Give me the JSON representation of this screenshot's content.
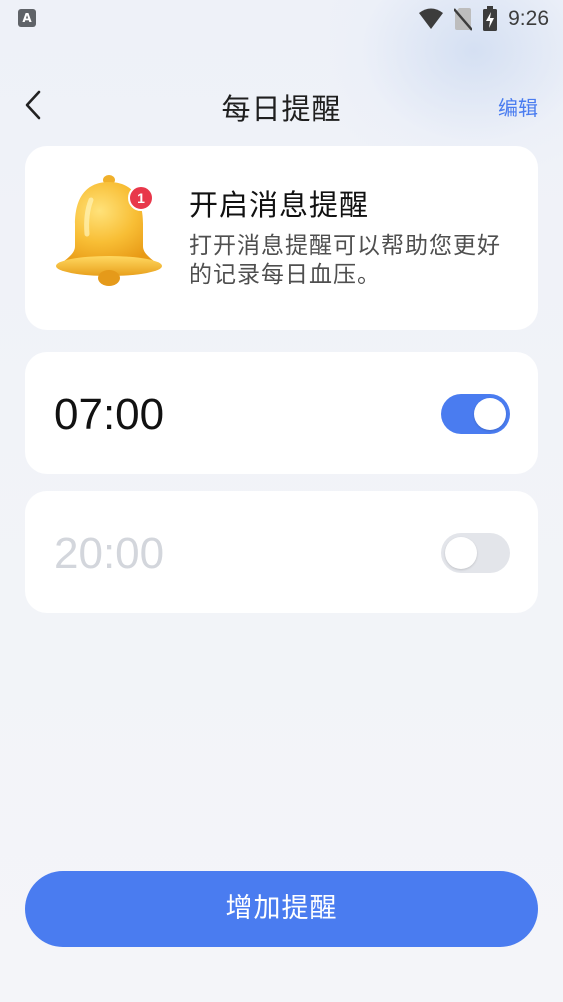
{
  "status_bar": {
    "app_icon_letter": "A",
    "time": "9:26",
    "icons": [
      "wifi-icon",
      "no-sim-icon",
      "battery-charging-icon"
    ]
  },
  "header": {
    "title": "每日提醒",
    "edit_label": "编辑",
    "back_icon": "chevron-left-icon"
  },
  "intro": {
    "badge_count": "1",
    "title": "开启消息提醒",
    "description": "打开消息提醒可以帮助您更好的记录每日血压。",
    "icon": "bell-icon"
  },
  "reminders": [
    {
      "time": "07:00",
      "enabled": true
    },
    {
      "time": "20:00",
      "enabled": false
    }
  ],
  "add_button_label": "增加提醒",
  "colors": {
    "accent": "#4a7cf0",
    "toggle_off": "#e3e5ea",
    "disabled_text": "#d3d6dc",
    "badge": "#e8374a",
    "bell": "#f5b731"
  }
}
